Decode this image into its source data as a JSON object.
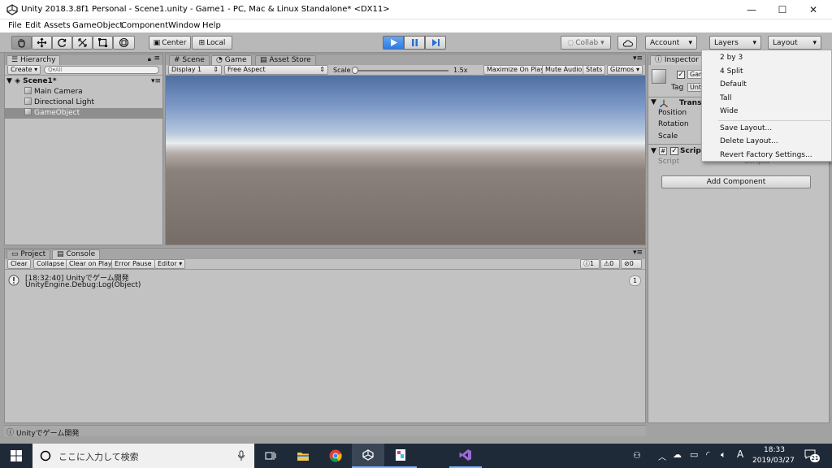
{
  "window": {
    "title": "Unity 2018.3.8f1 Personal - Scene1.unity - Game1 - PC, Mac & Linux Standalone* <DX11>",
    "minimize": "—",
    "maximize": "☐",
    "close": "✕"
  },
  "menu": [
    "File",
    "Edit",
    "Assets",
    "GameObject",
    "Component",
    "Window",
    "Help"
  ],
  "toolbar": {
    "center": "Center",
    "local": "Local",
    "collab": "Collab ▾",
    "account": "Account",
    "layers": "Layers",
    "layout": "Layout"
  },
  "hierarchy": {
    "tab": "Hierarchy",
    "create": "Create ▾",
    "search_placeholder": "Q▾All",
    "scene": "Scene1*",
    "items": [
      "Main Camera",
      "Directional Light",
      "GameObject"
    ]
  },
  "center_tabs": [
    "Scene",
    "Game",
    "Asset Store"
  ],
  "game_toolbar": {
    "display": "Display 1",
    "aspect": "Free Aspect",
    "scale_label": "Scale",
    "scale_value": "1.5x",
    "maximize": "Maximize On Play",
    "mute": "Mute Audio",
    "stats": "Stats",
    "gizmos": "Gizmos"
  },
  "bottom_tabs": [
    "Project",
    "Console"
  ],
  "console": {
    "buttons": [
      "Clear",
      "Collapse",
      "Clear on Play",
      "Error Pause",
      "Editor"
    ],
    "counts": [
      "1",
      "0",
      "0"
    ],
    "entry_line1": "[18:32:40] Unityでゲーム開発",
    "entry_line2": "UnityEngine.Debug:Log(Object)",
    "entry_count": "1"
  },
  "status_bar": "Unityでゲーム開発",
  "inspector": {
    "tab": "Inspector",
    "object_name": "Gam",
    "tag_label": "Tag",
    "tag_value": "Unt",
    "transform": "Trans",
    "position": "Position",
    "rotation": "Rotation",
    "scale": "Scale",
    "script_comp": "Scrip",
    "script_label": "Script",
    "script_value": "Scripts",
    "add_component": "Add Component"
  },
  "layout_menu": {
    "items": [
      "2 by 3",
      "4 Split",
      "Default",
      "Tall",
      "Wide"
    ],
    "actions": [
      "Save Layout...",
      "Delete Layout...",
      "Revert Factory Settings..."
    ]
  },
  "taskbar": {
    "search_placeholder": "ここに入力して検索",
    "time": "18:33",
    "date": "2019/03/27",
    "ime": "A",
    "notifications": "21"
  },
  "colors": {
    "play_active": "#2b7ce3",
    "taskbar": "#1f2a38"
  }
}
